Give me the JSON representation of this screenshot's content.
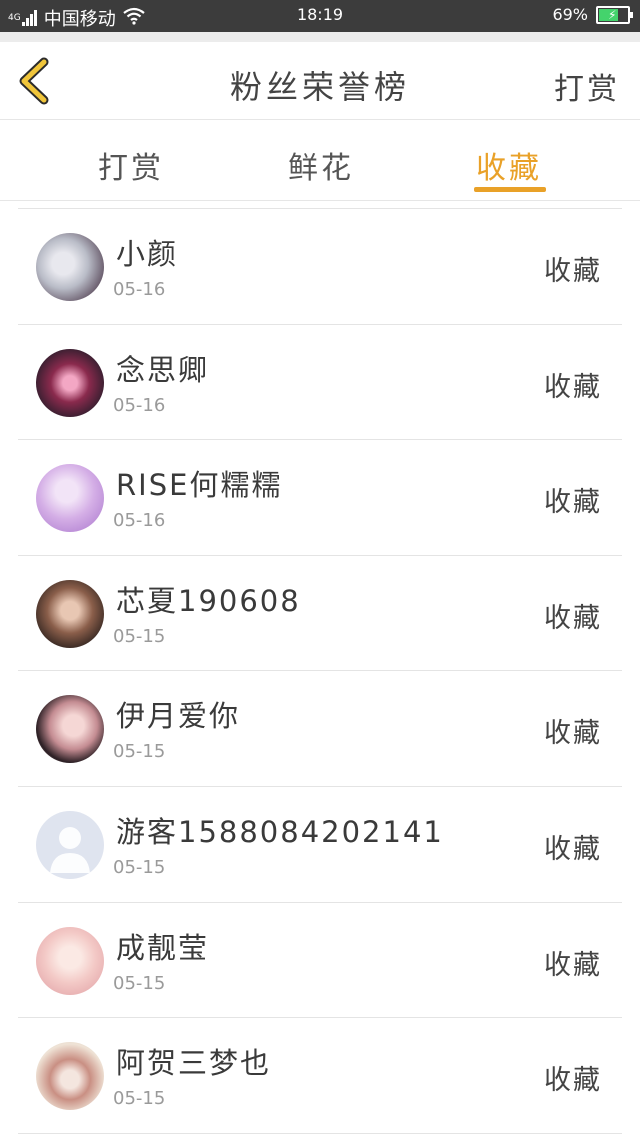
{
  "status_bar": {
    "network": "4G",
    "carrier": "中国移动",
    "time": "18:19",
    "battery_percent": "69%",
    "battery_level": 0.69,
    "battery_color": "#44d36c"
  },
  "header": {
    "title": "粉丝荣誉榜",
    "action": "打赏"
  },
  "tabs": {
    "items": [
      "打赏",
      "鲜花",
      "收藏"
    ],
    "active_index": 2,
    "active_color": "#e9a128"
  },
  "list": {
    "items": [
      {
        "name": "小颜",
        "date": "05-16",
        "tag": "收藏"
      },
      {
        "name": "念思卿",
        "date": "05-16",
        "tag": "收藏"
      },
      {
        "name": "RISE何糯糯",
        "date": "05-16",
        "tag": "收藏"
      },
      {
        "name": "芯夏190608",
        "date": "05-15",
        "tag": "收藏"
      },
      {
        "name": "伊月爱你",
        "date": "05-15",
        "tag": "收藏"
      },
      {
        "name": "游客15880842021​41",
        "date": "05-15",
        "tag": "收藏"
      },
      {
        "name": "成靓莹",
        "date": "05-15",
        "tag": "收藏"
      },
      {
        "name": "阿贺三梦也",
        "date": "05-15",
        "tag": "收藏"
      }
    ]
  },
  "icons": {
    "back": "chevron-left-icon",
    "wifi": "wifi-icon",
    "signal": "signal-icon",
    "battery": "battery-icon"
  }
}
